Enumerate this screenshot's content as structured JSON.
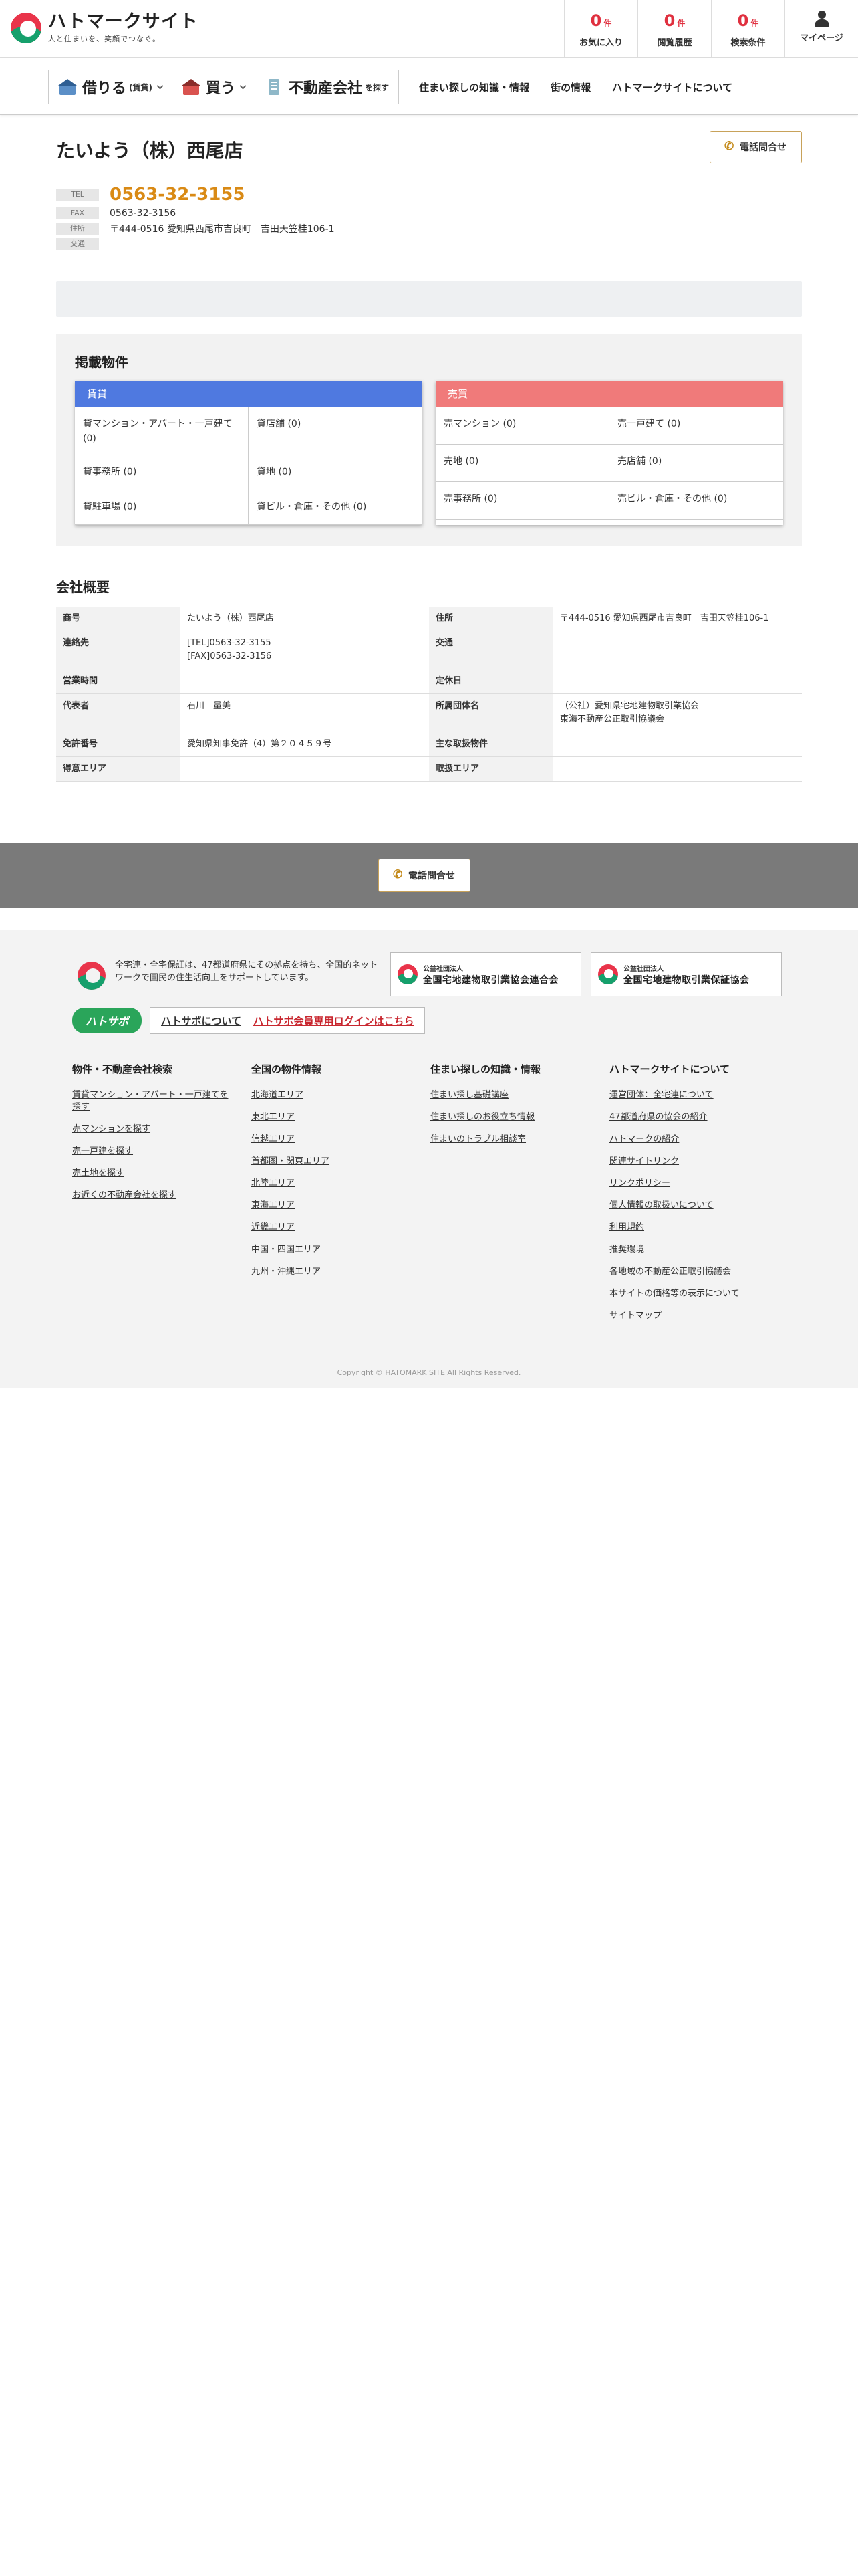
{
  "header": {
    "logo_name": "ハトマークサイト",
    "logo_tagline": "人と住まいを、笑顔でつなぐ。",
    "stats": [
      {
        "count": "0",
        "unit": "件",
        "label": "お気に入り"
      },
      {
        "count": "0",
        "unit": "件",
        "label": "閲覧履歴"
      },
      {
        "count": "0",
        "unit": "件",
        "label": "検索条件"
      }
    ],
    "mypage_label": "マイページ"
  },
  "nav": {
    "rent_label": "借りる",
    "rent_sub": "(賃貸)",
    "buy_label": "買う",
    "agency_label": "不動産会社",
    "agency_sub": "を探す",
    "links": [
      "住まい探しの知識・情報",
      "街の情報",
      "ハトマークサイトについて"
    ]
  },
  "company": {
    "name": "たいよう（株）西尾店",
    "contact_button": "電話問合せ",
    "tel_label": "TEL",
    "tel": "0563-32-3155",
    "fax_label": "FAX",
    "fax": "0563-32-3156",
    "address_label": "住所",
    "address": "〒444-0516 愛知県西尾市吉良町　吉田天笠桂106-1",
    "access_label": "交通",
    "access": ""
  },
  "listings": {
    "title": "掲載物件",
    "rent": {
      "header": "賃貸",
      "items": [
        "貸マンション・アパート・一戸建て (0)",
        "貸店舗 (0)",
        "貸事務所 (0)",
        "貸地 (0)",
        "貸駐車場 (0)",
        "貸ビル・倉庫・その他 (0)"
      ]
    },
    "sale": {
      "header": "売買",
      "items": [
        "売マンション (0)",
        "売一戸建て (0)",
        "売地 (0)",
        "売店舗 (0)",
        "売事務所 (0)",
        "売ビル・倉庫・その他 (0)"
      ]
    }
  },
  "overview": {
    "title": "会社概要",
    "rows": [
      {
        "k1": "商号",
        "v1": "たいよう（株）西尾店",
        "k2": "住所",
        "v2": "〒444-0516 愛知県西尾市吉良町　吉田天笠桂106-1"
      },
      {
        "k1": "連絡先",
        "v1": "[TEL]0563-32-3155\n[FAX]0563-32-3156",
        "k2": "交通",
        "v2": ""
      },
      {
        "k1": "営業時間",
        "v1": "",
        "k2": "定休日",
        "v2": ""
      },
      {
        "k1": "代表者",
        "v1": "石川　量美",
        "k2": "所属団体名",
        "v2": "（公社）愛知県宅地建物取引業協会\n東海不動産公正取引協議会"
      },
      {
        "k1": "免許番号",
        "v1": "愛知県知事免許（4）第２０４５９号",
        "k2": "主な取扱物件",
        "v2": ""
      },
      {
        "k1": "得意エリア",
        "v1": "",
        "k2": "取扱エリア",
        "v2": ""
      }
    ]
  },
  "cta": {
    "button": "電話問合せ"
  },
  "footer": {
    "description": "全宅連・全宅保証は、47都道府県にその拠点を持ち、全国的ネットワークで国民の住生活向上をサポートしています。",
    "assoc1_sub": "公益社団法人",
    "assoc1_name": "全国宅地建物取引業協会連合会",
    "assoc2_sub": "公益社団法人",
    "assoc2_name": "全国宅地建物取引業保証協会",
    "hatosapo_logo": "ハトサポ",
    "hatosapo_about": "ハトサポについて",
    "hatosapo_login": "ハトサポ会員専用ログインはこちら",
    "columns": [
      {
        "title": "物件・不動産会社検索",
        "links": [
          "賃貸マンション・アパート・一戸建てを探す",
          "売マンションを探す",
          "売一戸建を探す",
          "売土地を探す",
          "お近くの不動産会社を探す"
        ]
      },
      {
        "title": "全国の物件情報",
        "links": [
          "北海道エリア",
          "東北エリア",
          "信越エリア",
          "首都圏・関東エリア",
          "北陸エリア",
          "東海エリア",
          "近畿エリア",
          "中国・四国エリア",
          "九州・沖縄エリア"
        ]
      },
      {
        "title": "住まい探しの知識・情報",
        "links": [
          "住まい探し基礎講座",
          "住まい探しのお役立ち情報",
          "住まいのトラブル相談室"
        ]
      },
      {
        "title": "ハトマークサイトについて",
        "links": [
          "運営団体：全宅連について",
          "47都道府県の協会の紹介",
          "ハトマークの紹介",
          "関連サイトリンク",
          "リンクポリシー",
          "個人情報の取扱いについて",
          "利用規約",
          "推奨環境",
          "各地域の不動産公正取引協議会",
          "本サイトの価格等の表示について",
          "サイトマップ"
        ]
      }
    ],
    "copyright": "Copyright © HATOMARK SITE All Rights Reserved."
  }
}
